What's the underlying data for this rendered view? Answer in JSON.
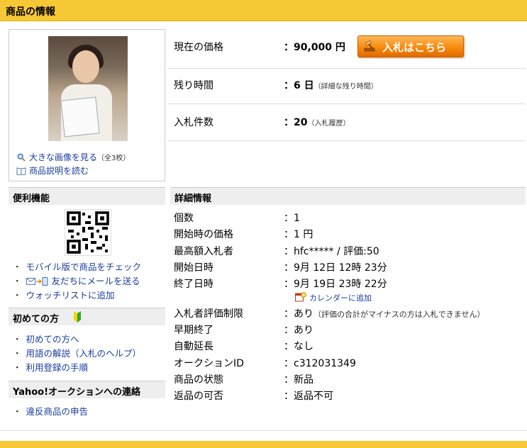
{
  "header": {
    "title": "商品の情報"
  },
  "image_box": {
    "view_large": "大きな画像を見る",
    "view_count": "（全3枚）",
    "read_desc": "商品説明を読む"
  },
  "summary": {
    "price_label": "現在の価格",
    "price_value": "：90,000 円",
    "bid_button": "入札はこちら",
    "time_label": "残り時間",
    "time_value": "：6 日",
    "time_link": "（詳細な残り時間）",
    "bids_label": "入札件数",
    "bids_value": "：20",
    "bids_link": "（入札履歴）"
  },
  "sidebar": {
    "tools_title": "便利機能",
    "tools": [
      "モバイル版で商品をチェック",
      "友だちにメールを送る",
      "ウォッチリストに追加"
    ],
    "beginner_title": "初めての方",
    "beginner": [
      "初めての方へ",
      "用語の解説（入札のヘルプ）",
      "利用登録の手順"
    ],
    "contact_title": "Yahoo!オークションへの連絡",
    "contact": [
      "違反商品の申告"
    ]
  },
  "details": {
    "title": "詳細情報",
    "rows": [
      {
        "label": "個数",
        "value": "：1"
      },
      {
        "label": "開始時の価格",
        "value": "：1 円"
      },
      {
        "label": "最高額入札者",
        "value": "：hfc***** / 評価:50"
      },
      {
        "label": "開始日時",
        "value": "：9月 12日 12時 23分"
      },
      {
        "label": "終了日時",
        "value": "：9月 19日 23時 22分"
      },
      {
        "label": "入札者評価制限",
        "value": "：あり",
        "note": "（評価の合計がマイナスの方は入札できません）"
      },
      {
        "label": "早期終了",
        "value": "：あり"
      },
      {
        "label": "自動延長",
        "value": "：なし"
      },
      {
        "label": "オークションID",
        "value": "：c312031349"
      },
      {
        "label": "商品の状態",
        "value": "：新品"
      },
      {
        "label": "返品の可否",
        "value": "：返品不可"
      }
    ],
    "calendar_link": "カレンダーに追加"
  }
}
